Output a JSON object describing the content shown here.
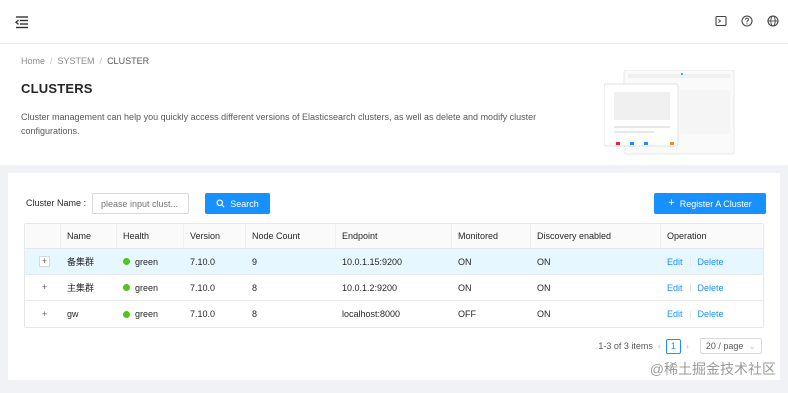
{
  "breadcrumb": [
    "Home",
    "SYSTEM",
    "CLUSTER"
  ],
  "page": {
    "title": "CLUSTERS",
    "description": "Cluster management can help you quickly access different versions of Elasticsearch clusters, as well as delete and modify cluster configurations."
  },
  "filter": {
    "label": "Cluster Name :",
    "placeholder": "please input clust...",
    "search_label": "Search"
  },
  "register_label": "Register A Cluster",
  "table": {
    "columns": [
      "Name",
      "Health",
      "Version",
      "Node Count",
      "Endpoint",
      "Monitored",
      "Discovery enabled",
      "Operation"
    ],
    "rows": [
      {
        "name": "备集群",
        "health": "green",
        "version": "7.10.0",
        "nodes": "9",
        "endpoint": "10.0.1.15:9200",
        "monitored": "ON",
        "discovery": "ON",
        "edit": "Edit",
        "delete": "Delete"
      },
      {
        "name": "主集群",
        "health": "green",
        "version": "7.10.0",
        "nodes": "8",
        "endpoint": "10.0.1.2:9200",
        "monitored": "ON",
        "discovery": "ON",
        "edit": "Edit",
        "delete": "Delete"
      },
      {
        "name": "gw",
        "health": "green",
        "version": "7.10.0",
        "nodes": "8",
        "endpoint": "localhost:8000",
        "monitored": "OFF",
        "discovery": "ON",
        "edit": "Edit",
        "delete": "Delete"
      }
    ]
  },
  "pagination": {
    "total_text": "1-3 of 3 items",
    "current_page": "1",
    "page_size": "20 / page"
  },
  "watermark": "@稀土掘金技术社区",
  "colors": {
    "primary": "#1890ff",
    "health_green": "#52c41a"
  }
}
